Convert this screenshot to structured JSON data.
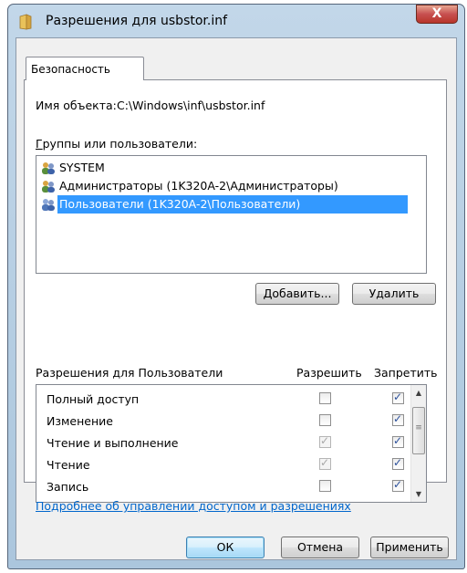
{
  "window": {
    "title": "Разрешения для usbstor.inf",
    "close_glyph": "X"
  },
  "tab": {
    "label": "Безопасность"
  },
  "object": {
    "label": "Имя объекта:",
    "value": "C:\\Windows\\inf\\usbstor.inf"
  },
  "groups": {
    "label": "Группы или пользователи:",
    "items": [
      {
        "name": "SYSTEM",
        "selected": false
      },
      {
        "name": "Администраторы (1K320A-2\\Администраторы)",
        "selected": false
      },
      {
        "name": "Пользователи (1K320A-2\\Пользователи)",
        "selected": true
      }
    ],
    "add_button": "Добавить...",
    "remove_button": "Удалить"
  },
  "permissions": {
    "label": "Разрешения для Пользователи",
    "allow_header": "Разрешить",
    "deny_header": "Запретить",
    "rows": [
      {
        "name": "Полный доступ",
        "allow": false,
        "allow_inherited": false,
        "deny": true
      },
      {
        "name": "Изменение",
        "allow": false,
        "allow_inherited": false,
        "deny": true
      },
      {
        "name": "Чтение и выполнение",
        "allow": true,
        "allow_inherited": true,
        "deny": true
      },
      {
        "name": "Чтение",
        "allow": true,
        "allow_inherited": true,
        "deny": true
      },
      {
        "name": "Запись",
        "allow": false,
        "allow_inherited": false,
        "deny": true
      }
    ]
  },
  "link": {
    "text": "Подробнее об управлении доступом и разрешениях"
  },
  "footer": {
    "ok": "ОК",
    "cancel": "Отмена",
    "apply": "Применить"
  }
}
